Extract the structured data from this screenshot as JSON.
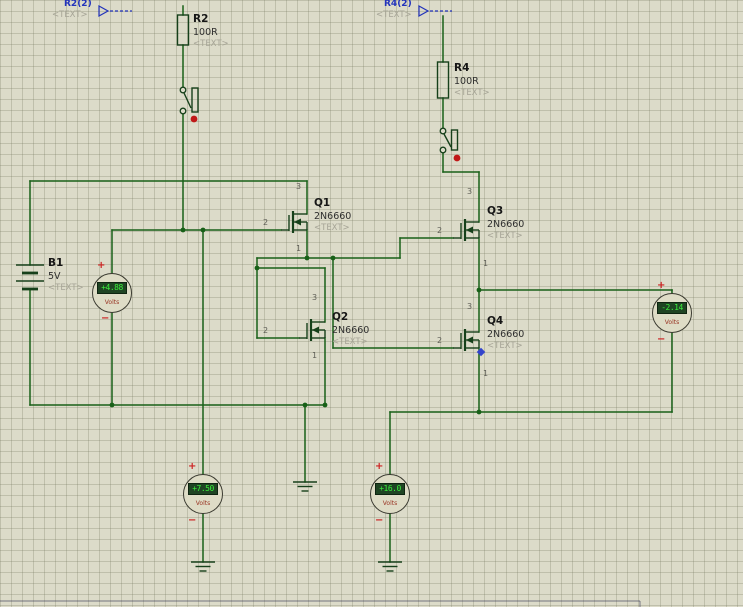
{
  "placeholder": "<TEXT>",
  "probes": {
    "p1": {
      "label": "R2(2)"
    },
    "p2": {
      "label": "R4(2)"
    }
  },
  "components": {
    "r2": {
      "ref": "R2",
      "value": "100R"
    },
    "r4": {
      "ref": "R4",
      "value": "100R"
    },
    "b1": {
      "ref": "B1",
      "value": "5V"
    },
    "q1": {
      "ref": "Q1",
      "value": "2N6660",
      "pin_top": "3",
      "pin_gate": "2",
      "pin_bottom": "1"
    },
    "q2": {
      "ref": "Q2",
      "value": "2N6660",
      "pin_top": "3",
      "pin_gate": "2",
      "pin_bottom": "1"
    },
    "q3": {
      "ref": "Q3",
      "value": "2N6660",
      "pin_top": "3",
      "pin_gate": "2",
      "pin_bottom": "1"
    },
    "q4": {
      "ref": "Q4",
      "value": "2N6660",
      "pin_top": "3",
      "pin_gate": "2",
      "pin_bottom": "1"
    }
  },
  "meters": {
    "vm_battery": {
      "reading": "+4.88",
      "unit": "Volts"
    },
    "vm_left": {
      "reading": "+7.50",
      "unit": "Volts"
    },
    "vm_mid": {
      "reading": "+16.0",
      "unit": "Volts"
    },
    "vm_right": {
      "reading": "-2.14",
      "unit": "Volts"
    }
  },
  "signs": {
    "plus": "+",
    "minus": "−"
  },
  "colors": {
    "canvas_bg": "#DCDBC9",
    "wire": "#186018",
    "ink": "#16401A",
    "warning_dot": "#C01818",
    "probe_blue": "#2233BB",
    "lcd_bg": "#1F4423",
    "lcd_text": "#3CF03C",
    "meter_unit": "#993322"
  }
}
